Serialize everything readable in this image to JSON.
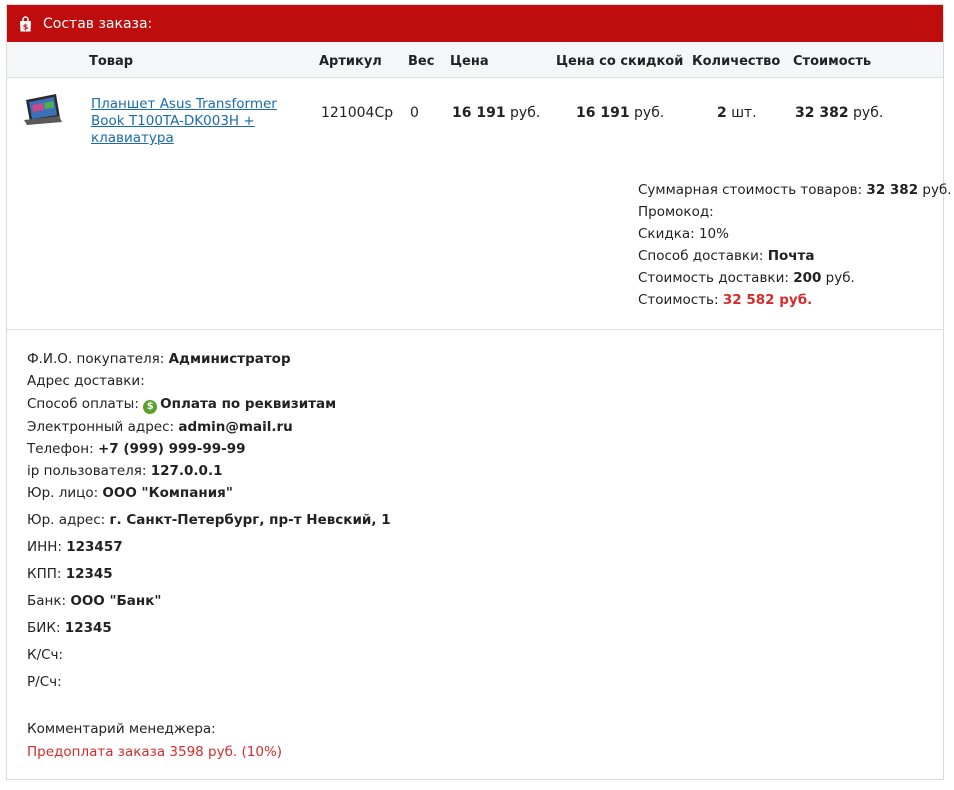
{
  "header": {
    "title": "Состав заказа:",
    "icon": "shopping-bag-icon",
    "color": "#bf0d0d"
  },
  "table": {
    "columns": [
      "Товар",
      "Артикул",
      "Вес",
      "Цена",
      "Цена со скидкой",
      "Количество",
      "Стоимость"
    ],
    "row": {
      "product_name": "Планшет Asus Transformer Book T100TA-DK003H + клавиатура",
      "article": "121004Ср",
      "weight": "0",
      "price": "16 191",
      "price_currency": " руб.",
      "discount_price": "16 191",
      "discount_currency": " руб.",
      "quantity": "2",
      "quantity_unit": " шт.",
      "total": "32 382",
      "total_currency": " руб."
    }
  },
  "summary": {
    "goods_total_label": "Суммарная стоимость товаров: ",
    "goods_total_value": "32 382",
    "goods_total_currency": " руб.",
    "promo_label": "Промокод:",
    "discount_label": "Скидка: 10%",
    "delivery_method_label": "Способ доставки: ",
    "delivery_method_value": "Почта",
    "delivery_cost_label": "Стоимость доставки: ",
    "delivery_cost_value": "200",
    "delivery_cost_currency": " руб.",
    "total_label": "Стоимость: ",
    "total_value": "32 582 руб."
  },
  "customer": {
    "name_label": "Ф.И.О. покупателя: ",
    "name_value": "Администратор",
    "address_label": "Адрес доставки:",
    "payment_label": "Способ оплаты: ",
    "payment_icon": "$",
    "payment_value": "Оплата по реквизитам",
    "email_label": "Электронный адрес: ",
    "email_value": "admin@mail.ru",
    "phone_label": "Телефон: ",
    "phone_value": "+7 (999) 999-99-99",
    "ip_label": "ip пользователя: ",
    "ip_value": "127.0.0.1",
    "legal_label": "Юр. лицо: ",
    "legal_value": "ООО \"Компания\"",
    "legal_address_label": "Юр. адрес: ",
    "legal_address_value": "г. Санкт-Петербург, пр-т Невский, 1",
    "inn_label": "ИНН: ",
    "inn_value": "123457",
    "kpp_label": "КПП: ",
    "kpp_value": "12345",
    "bank_label": "Банк: ",
    "bank_value": "ООО \"Банк\"",
    "bik_label": "БИК: ",
    "bik_value": "12345",
    "ks_label": "К/Сч:",
    "rs_label": "Р/Сч:"
  },
  "comment": {
    "label": "Комментарий менеджера:",
    "text": "Предоплата заказа 3598 руб. (10%)",
    "color": "#d52b2b"
  }
}
